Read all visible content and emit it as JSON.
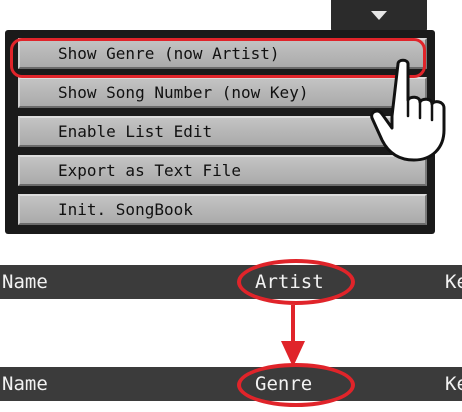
{
  "menu": {
    "items": [
      {
        "label": "Show Genre (now Artist)"
      },
      {
        "label": "Show Song Number (now Key)"
      },
      {
        "label": "Enable List Edit"
      },
      {
        "label": "Export as Text File"
      },
      {
        "label": "Init. SongBook"
      }
    ]
  },
  "header_before": {
    "name_label": "Name",
    "second_label": "Artist",
    "third_label": "Ke"
  },
  "header_after": {
    "name_label": "Name",
    "second_label": "Genre",
    "third_label": "Ke"
  },
  "colors": {
    "highlight": "#e0242a",
    "menu_item": "#b8b8b8",
    "header_bar": "#3b3b3b"
  },
  "icons": {
    "menu_tab": "triangle-down-icon",
    "pointer": "pointing-hand-icon",
    "transition": "arrow-down-icon"
  }
}
